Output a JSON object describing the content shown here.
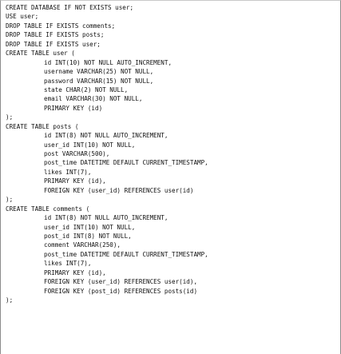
{
  "code": {
    "lines": [
      {
        "indent": false,
        "text": "CREATE DATABASE IF NOT EXISTS user;"
      },
      {
        "indent": false,
        "text": "USE user;"
      },
      {
        "indent": false,
        "text": "DROP TABLE IF EXISTS comments;"
      },
      {
        "indent": false,
        "text": "DROP TABLE IF EXISTS posts;"
      },
      {
        "indent": false,
        "text": "DROP TABLE IF EXISTS user;"
      },
      {
        "indent": false,
        "text": "CREATE TABLE user ("
      },
      {
        "indent": true,
        "text": "id INT(10) NOT NULL AUTO_INCREMENT,"
      },
      {
        "indent": true,
        "text": "username VARCHAR(25) NOT NULL,"
      },
      {
        "indent": true,
        "text": "password VARCHAR(15) NOT NULL,"
      },
      {
        "indent": true,
        "text": "state CHAR(2) NOT NULL,"
      },
      {
        "indent": true,
        "text": "email VARCHAR(30) NOT NULL,"
      },
      {
        "indent": true,
        "text": "PRIMARY KEY (id)"
      },
      {
        "indent": false,
        "text": ");"
      },
      {
        "indent": false,
        "text": "CREATE TABLE posts ("
      },
      {
        "indent": true,
        "text": "id INT(8) NOT NULL AUTO_INCREMENT,"
      },
      {
        "indent": true,
        "text": "user_id INT(10) NOT NULL,"
      },
      {
        "indent": true,
        "text": "post VARCHAR(500),"
      },
      {
        "indent": true,
        "text": "post_time DATETIME DEFAULT CURRENT_TIMESTAMP,"
      },
      {
        "indent": true,
        "text": "likes INT(7),"
      },
      {
        "indent": true,
        "text": "PRIMARY KEY (id),"
      },
      {
        "indent": true,
        "text": "FOREIGN KEY (user_id) REFERENCES user(id)"
      },
      {
        "indent": false,
        "text": ");"
      },
      {
        "indent": false,
        "text": "CREATE TABLE comments ("
      },
      {
        "indent": true,
        "text": "id INT(8) NOT NULL AUTO_INCREMENT,"
      },
      {
        "indent": true,
        "text": "user_id INT(10) NOT NULL,"
      },
      {
        "indent": true,
        "text": "post_id INT(8) NOT NULL,"
      },
      {
        "indent": true,
        "text": "comment VARCHAR(250),"
      },
      {
        "indent": true,
        "text": "post_time DATETIME DEFAULT CURRENT_TIMESTAMP,"
      },
      {
        "indent": true,
        "text": "likes INT(7),"
      },
      {
        "indent": true,
        "text": "PRIMARY KEY (id),"
      },
      {
        "indent": true,
        "text": "FOREIGN KEY (user_id) REFERENCES user(id),"
      },
      {
        "indent": true,
        "text": "FOREIGN KEY (post_id) REFERENCES posts(id)"
      },
      {
        "indent": false,
        "text": ");"
      }
    ]
  },
  "colors": {
    "background": "#ffffff",
    "text": "#111111",
    "border": "#8c8c8c"
  }
}
